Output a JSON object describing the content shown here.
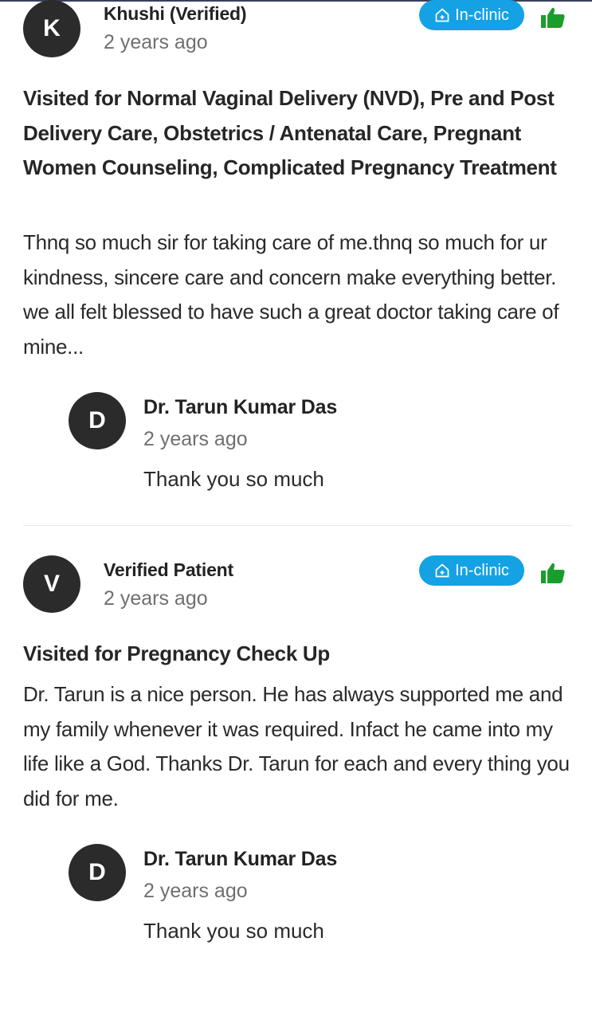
{
  "reviews": [
    {
      "avatar_letter": "K",
      "name": "Khushi (Verified)",
      "time": "2 years ago",
      "badge_label": "In-clinic",
      "badge_icon": "home-icon",
      "recommend_icon": "thumbs-up-icon",
      "visited_for": "Visited for Normal Vaginal Delivery (NVD), Pre and Post Delivery Care, Obstetrics / Antenatal Care, Pregnant Women Counseling, Complicated Pregnancy Treatment",
      "text": "Thnq so much sir for taking care of me.thnq so much for ur kindness, sincere care and concern make everything better. we all felt blessed to have such a great doctor taking care of mine...",
      "reply": {
        "avatar_letter": "D",
        "name": "Dr. Tarun Kumar Das",
        "time": "2 years ago",
        "text": "Thank you so much"
      }
    },
    {
      "avatar_letter": "V",
      "name": "Verified Patient",
      "time": "2 years ago",
      "badge_label": "In-clinic",
      "badge_icon": "home-icon",
      "recommend_icon": "thumbs-up-icon",
      "visited_for": "Visited for Pregnancy Check Up",
      "text": "Dr. Tarun is a nice person. He has always supported me and my family whenever it was required. Infact he came into my life like a God. Thanks Dr. Tarun for each and every thing you did for me.",
      "reply": {
        "avatar_letter": "D",
        "name": "Dr. Tarun Kumar Das",
        "time": "2 years ago",
        "text": "Thank you so much"
      }
    }
  ],
  "colors": {
    "badge": "#14a2e5",
    "thumbs_up": "#1a9e2b",
    "avatar": "#2b2b2b"
  }
}
